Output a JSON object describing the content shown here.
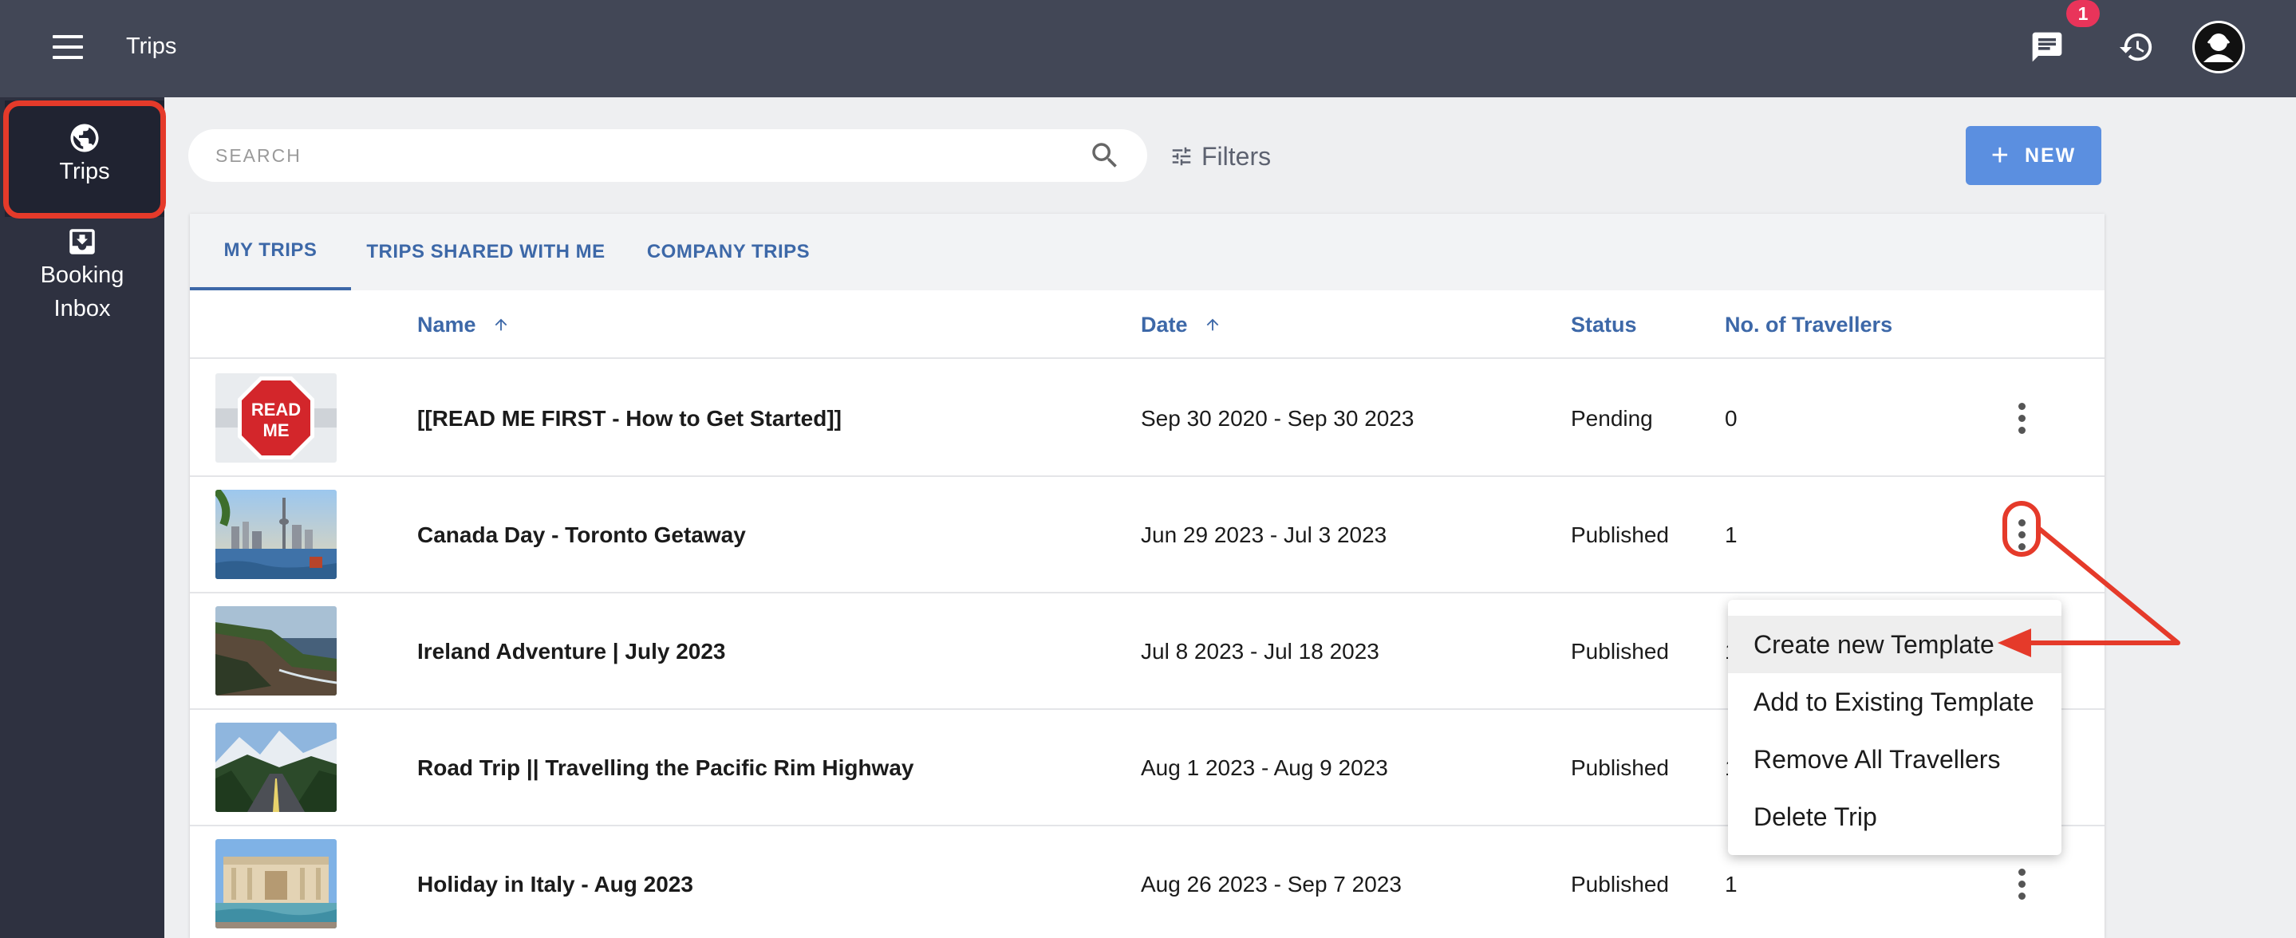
{
  "header": {
    "title": "Trips",
    "notification_count": "1"
  },
  "sidebar": {
    "items": [
      {
        "label": "Trips",
        "icon": "globe-icon",
        "active": true
      },
      {
        "label": "Booking Inbox",
        "icon": "inbox-download-icon",
        "active": false
      }
    ]
  },
  "toolbar": {
    "search_placeholder": "SEARCH",
    "filters_label": "Filters",
    "new_label": "NEW"
  },
  "tabs": [
    {
      "label": "MY TRIPS",
      "active": true
    },
    {
      "label": "TRIPS SHARED WITH ME",
      "active": false
    },
    {
      "label": "COMPANY TRIPS",
      "active": false
    }
  ],
  "table": {
    "columns": [
      "Name",
      "Date",
      "Status",
      "No. of Travellers"
    ],
    "rows": [
      {
        "name": "[[READ ME FIRST - How to Get Started]]",
        "date": "Sep 30 2020 - Sep 30 2023",
        "status": "Pending",
        "travellers": "0",
        "thumbnail": "read-me-stop-sign"
      },
      {
        "name": "Canada Day - Toronto Getaway",
        "date": "Jun 29 2023 - Jul 3 2023",
        "status": "Published",
        "travellers": "1",
        "thumbnail": "toronto-skyline"
      },
      {
        "name": "Ireland Adventure | July 2023",
        "date": "Jul 8 2023 - Jul 18 2023",
        "status": "Published",
        "travellers": "1",
        "thumbnail": "ireland-cliffs"
      },
      {
        "name": "Road Trip || Travelling the Pacific Rim Highway",
        "date": "Aug 1 2023 - Aug 9 2023",
        "status": "Published",
        "travellers": "1",
        "thumbnail": "mountain-highway"
      },
      {
        "name": "Holiday in Italy - Aug 2023",
        "date": "Aug 26 2023 - Sep 7 2023",
        "status": "Published",
        "travellers": "1",
        "thumbnail": "trevi-fountain"
      }
    ],
    "thumbnail_text": {
      "read_me": "READ",
      "me": "ME"
    }
  },
  "context_menu": {
    "items": [
      "Create new Template",
      "Add to Existing Template",
      "Remove All Travellers",
      "Delete Trip"
    ],
    "highlighted": "Create new Template"
  },
  "colors": {
    "topbar": "#424756",
    "sidebar": "#2e3140",
    "accent": "#3d68a8",
    "new_button": "#5b8fe0",
    "badge": "#e9345a",
    "annotation": "#e53a2a"
  }
}
